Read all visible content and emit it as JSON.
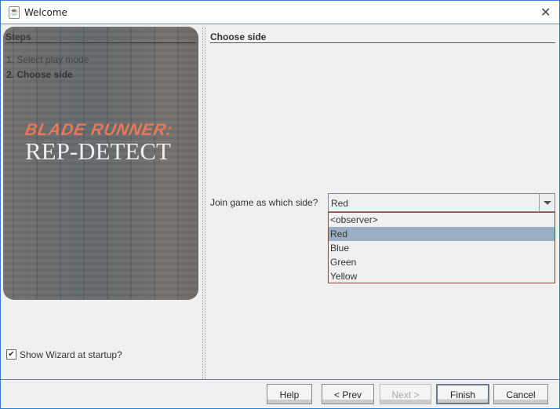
{
  "window": {
    "title": "Welcome"
  },
  "steps": {
    "header": "Steps",
    "items": [
      "1. Select play mode",
      "2. Choose side"
    ]
  },
  "banner": {
    "line1": "BLADE RUNNER:",
    "line2": "REP-DETECT"
  },
  "main": {
    "header": "Choose side",
    "join_label": "Join game as which side?",
    "selected": "Red",
    "options": [
      "<observer>",
      "Red",
      "Blue",
      "Green",
      "Yellow"
    ],
    "highlight_color": "#9caec4"
  },
  "show_wizard": {
    "label": "Show Wizard at startup?",
    "checked": true
  },
  "buttons": {
    "help": "Help",
    "prev": "< Prev",
    "next": "Next >",
    "finish": "Finish",
    "cancel": "Cancel"
  }
}
